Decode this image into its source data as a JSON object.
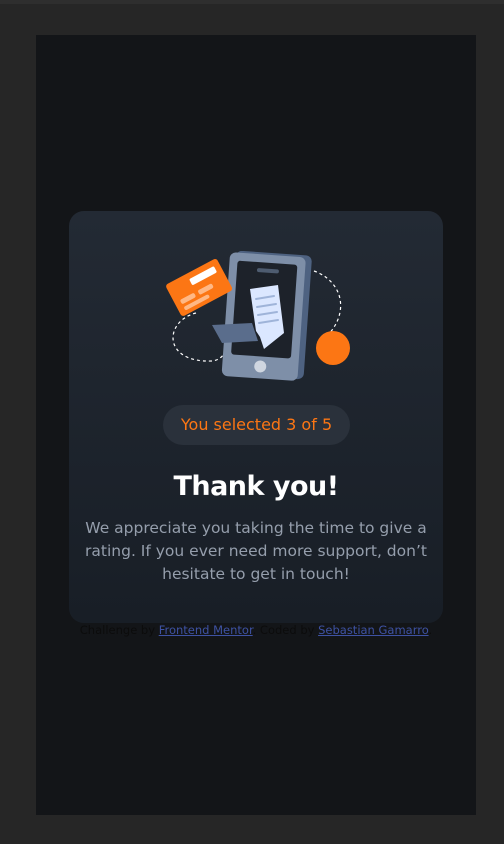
{
  "card": {
    "selected_text": "You selected 3 of 5",
    "title": "Thank you!",
    "message": "We appreciate you taking the time to give a rating. If you ever need more support, don’t hesitate to get in touch!"
  },
  "attribution": {
    "prefix": "Challenge by",
    "mentor_link": "Frontend Mentor",
    "middle": ". Coded by",
    "author_link": "Sebastian Gamarro",
    "suffix": "."
  },
  "colors": {
    "accent": "#fc7614",
    "card_top": "#232a34",
    "card_bottom": "#181e26",
    "body_text": "#959eac",
    "page_bg": "#131518",
    "link": "#3e52a3"
  },
  "icons": {
    "illustration": "thank-you-illustration"
  }
}
